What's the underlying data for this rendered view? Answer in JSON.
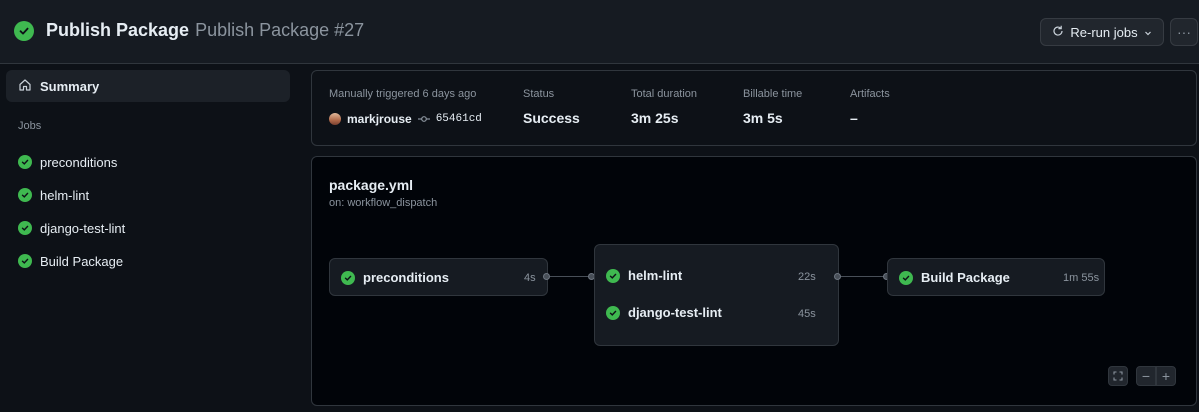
{
  "header": {
    "workflow_name": "Publish Package",
    "run_title": "Publish Package #27",
    "rerun_label": "Re-run jobs",
    "more_label": "···"
  },
  "sidebar": {
    "summary_label": "Summary",
    "jobs_heading": "Jobs",
    "jobs": [
      {
        "label": "preconditions",
        "status": "success"
      },
      {
        "label": "helm-lint",
        "status": "success"
      },
      {
        "label": "django-test-lint",
        "status": "success"
      },
      {
        "label": "Build Package",
        "status": "success"
      }
    ]
  },
  "run_info": {
    "trigger_label": "Manually triggered 6 days ago",
    "user": "markjrouse",
    "commit": "65461cd",
    "status_label": "Status",
    "status_value": "Success",
    "duration_label": "Total duration",
    "duration_value": "3m 25s",
    "billable_label": "Billable time",
    "billable_value": "3m 5s",
    "artifacts_label": "Artifacts",
    "artifacts_value": "–"
  },
  "graph": {
    "file": "package.yml",
    "trigger": "on: workflow_dispatch",
    "nodes": [
      {
        "label": "preconditions",
        "duration": "4s"
      },
      {
        "label": "helm-lint",
        "duration": "22s"
      },
      {
        "label": "django-test-lint",
        "duration": "45s"
      },
      {
        "label": "Build Package",
        "duration": "1m 55s"
      }
    ],
    "zoom_out_label": "−",
    "zoom_in_label": "+"
  },
  "colors": {
    "success": "#3fb950",
    "background": "#0d1117",
    "panel": "#161b22",
    "border": "#30363d"
  }
}
